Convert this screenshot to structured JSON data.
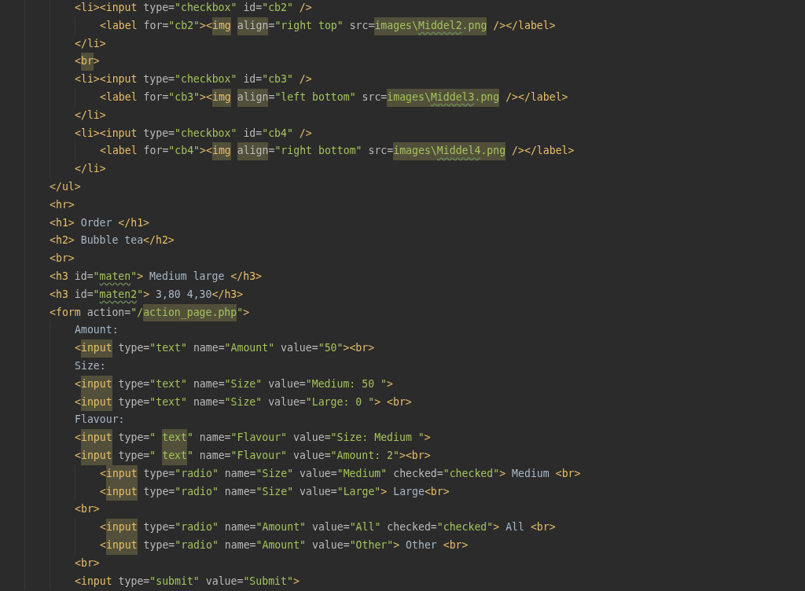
{
  "lines": [
    {
      "children": [
        {
          "tokens": [
            {
              "kind": "tag",
              "text": "<li><input"
            },
            {
              "kind": "attr",
              "text": " type="
            },
            {
              "kind": "string",
              "text": "\"checkbox\""
            },
            {
              "kind": "attr",
              "text": " id="
            },
            {
              "kind": "string",
              "text": "\"cb2\""
            },
            {
              "kind": "tag",
              "text": " />"
            }
          ],
          "children": [
            {
              "tokens": [
                {
                  "kind": "tag",
                  "text": "<label"
                },
                {
                  "kind": "attr",
                  "text": " for="
                },
                {
                  "kind": "string",
                  "text": "\"cb2\""
                },
                {
                  "kind": "tag",
                  "text": "><"
                },
                {
                  "kind": "tagmark",
                  "text": "img"
                },
                {
                  "kind": "attrmark",
                  "text": " align"
                },
                {
                  "kind": "attr",
                  "text": "="
                },
                {
                  "kind": "string",
                  "text": "\"right top\""
                },
                {
                  "kind": "attr",
                  "text": " src="
                },
                {
                  "kind": "stringmark",
                  "text": "images\\"
                },
                {
                  "kind": "stringmarktypo",
                  "text": "Middel2"
                },
                {
                  "kind": "stringmark",
                  "text": ".png"
                },
                {
                  "kind": "tag",
                  "text": " /></label>"
                }
              ]
            }
          ]
        },
        {
          "tokens": [
            {
              "kind": "tag",
              "text": "</li>"
            }
          ]
        },
        {
          "tokens": [
            {
              "kind": "tag",
              "text": "<"
            },
            {
              "kind": "tagmark",
              "text": "br"
            },
            {
              "kind": "tag",
              "text": ">"
            }
          ]
        },
        {
          "tokens": [
            {
              "kind": "tag",
              "text": "<li><input"
            },
            {
              "kind": "attr",
              "text": " type="
            },
            {
              "kind": "string",
              "text": "\"checkbox\""
            },
            {
              "kind": "attr",
              "text": " id="
            },
            {
              "kind": "string",
              "text": "\"cb3\""
            },
            {
              "kind": "tag",
              "text": " />"
            }
          ],
          "children": [
            {
              "tokens": [
                {
                  "kind": "tag",
                  "text": "<label"
                },
                {
                  "kind": "attr",
                  "text": " for="
                },
                {
                  "kind": "string",
                  "text": "\"cb3\""
                },
                {
                  "kind": "tag",
                  "text": "><"
                },
                {
                  "kind": "tagmark",
                  "text": "img"
                },
                {
                  "kind": "attrmark",
                  "text": " align"
                },
                {
                  "kind": "attr",
                  "text": "="
                },
                {
                  "kind": "string",
                  "text": "\"left bottom\""
                },
                {
                  "kind": "attr",
                  "text": " src="
                },
                {
                  "kind": "stringmark",
                  "text": "images\\"
                },
                {
                  "kind": "stringmarktypo",
                  "text": "Middel3"
                },
                {
                  "kind": "stringmark",
                  "text": ".png"
                },
                {
                  "kind": "tag",
                  "text": " /></label>"
                }
              ]
            }
          ]
        },
        {
          "tokens": [
            {
              "kind": "tag",
              "text": "</li>"
            }
          ]
        },
        {
          "tokens": [
            {
              "kind": "tag",
              "text": "<li><input"
            },
            {
              "kind": "attr",
              "text": " type="
            },
            {
              "kind": "string",
              "text": "\"checkbox\""
            },
            {
              "kind": "attr",
              "text": " id="
            },
            {
              "kind": "string",
              "text": "\"cb4\""
            },
            {
              "kind": "tag",
              "text": " />"
            }
          ],
          "children": [
            {
              "tokens": [
                {
                  "kind": "tag",
                  "text": "<label"
                },
                {
                  "kind": "attr",
                  "text": " for="
                },
                {
                  "kind": "string",
                  "text": "\"cb4\""
                },
                {
                  "kind": "tag",
                  "text": "><"
                },
                {
                  "kind": "tagmark",
                  "text": "img"
                },
                {
                  "kind": "attrmark",
                  "text": " align"
                },
                {
                  "kind": "attr",
                  "text": "="
                },
                {
                  "kind": "string",
                  "text": "\"right bottom\""
                },
                {
                  "kind": "attr",
                  "text": " src="
                },
                {
                  "kind": "stringmark",
                  "text": "images\\"
                },
                {
                  "kind": "stringmarktypo",
                  "text": "Middel4"
                },
                {
                  "kind": "stringmark",
                  "text": ".png"
                },
                {
                  "kind": "tag",
                  "text": " /></label>"
                }
              ]
            }
          ]
        },
        {
          "tokens": [
            {
              "kind": "tag",
              "text": "</li>"
            }
          ]
        }
      ]
    },
    {
      "tokens": [
        {
          "kind": "tag",
          "text": "</ul>"
        }
      ]
    },
    {
      "tokens": [
        {
          "kind": "tag",
          "text": "<hr>"
        }
      ]
    },
    {
      "tokens": [
        {
          "kind": "tag",
          "text": "<h1>"
        },
        {
          "kind": "plain",
          "text": " Order "
        },
        {
          "kind": "tag",
          "text": "</h1>"
        }
      ]
    },
    {
      "tokens": [
        {
          "kind": "tag",
          "text": "<h2>"
        },
        {
          "kind": "plain",
          "text": " Bubble tea"
        },
        {
          "kind": "tag",
          "text": "</h2>"
        }
      ]
    },
    {
      "tokens": [
        {
          "kind": "tag",
          "text": "<br>"
        }
      ]
    },
    {
      "tokens": [
        {
          "kind": "tag",
          "text": "<h3"
        },
        {
          "kind": "attr",
          "text": " id="
        },
        {
          "kind": "string",
          "text": "\""
        },
        {
          "kind": "stringtypo",
          "text": "maten"
        },
        {
          "kind": "string",
          "text": "\""
        },
        {
          "kind": "tag",
          "text": ">"
        },
        {
          "kind": "plain",
          "text": " Medium large "
        },
        {
          "kind": "tag",
          "text": "</h3>"
        }
      ]
    },
    {
      "tokens": [
        {
          "kind": "tag",
          "text": "<h3"
        },
        {
          "kind": "attr",
          "text": " id="
        },
        {
          "kind": "string",
          "text": "\""
        },
        {
          "kind": "stringtypo",
          "text": "maten2"
        },
        {
          "kind": "string",
          "text": "\""
        },
        {
          "kind": "tag",
          "text": ">"
        },
        {
          "kind": "plain",
          "text": " 3,80 4,30"
        },
        {
          "kind": "tag",
          "text": "</h3>"
        }
      ]
    },
    {
      "tokens": [
        {
          "kind": "tag",
          "text": "<form"
        },
        {
          "kind": "attr",
          "text": " action="
        },
        {
          "kind": "string",
          "text": "\"/"
        },
        {
          "kind": "stringmark",
          "text": "action_page.php"
        },
        {
          "kind": "string",
          "text": "\""
        },
        {
          "kind": "tag",
          "text": ">"
        }
      ],
      "children": [
        {
          "tokens": [
            {
              "kind": "plain",
              "text": "Amount:"
            }
          ]
        },
        {
          "tokens": [
            {
              "kind": "tag",
              "text": "<"
            },
            {
              "kind": "tagmark",
              "text": "input"
            },
            {
              "kind": "attr",
              "text": " type="
            },
            {
              "kind": "string",
              "text": "\"text\""
            },
            {
              "kind": "attr",
              "text": " name="
            },
            {
              "kind": "string",
              "text": "\"Amount\""
            },
            {
              "kind": "attr",
              "text": " value="
            },
            {
              "kind": "string",
              "text": "\"50\""
            },
            {
              "kind": "tag",
              "text": "><br>"
            }
          ]
        },
        {
          "tokens": [
            {
              "kind": "plain",
              "text": "Size:"
            }
          ]
        },
        {
          "tokens": [
            {
              "kind": "tag",
              "text": "<"
            },
            {
              "kind": "tagmark",
              "text": "input"
            },
            {
              "kind": "attr",
              "text": " type="
            },
            {
              "kind": "string",
              "text": "\"text\""
            },
            {
              "kind": "attr",
              "text": " name="
            },
            {
              "kind": "string",
              "text": "\"Size\""
            },
            {
              "kind": "attr",
              "text": " value="
            },
            {
              "kind": "string",
              "text": "\"Medium: 50 \""
            },
            {
              "kind": "tag",
              "text": ">"
            }
          ]
        },
        {
          "tokens": [
            {
              "kind": "tag",
              "text": "<"
            },
            {
              "kind": "tagmark",
              "text": "input"
            },
            {
              "kind": "attr",
              "text": " type="
            },
            {
              "kind": "string",
              "text": "\"text\""
            },
            {
              "kind": "attr",
              "text": " name="
            },
            {
              "kind": "string",
              "text": "\"Size\""
            },
            {
              "kind": "attr",
              "text": " value="
            },
            {
              "kind": "string",
              "text": "\"Large: 0 \""
            },
            {
              "kind": "tag",
              "text": "> <br>"
            }
          ]
        },
        {
          "tokens": [
            {
              "kind": "plain",
              "text": "Flavour:"
            }
          ]
        },
        {
          "tokens": [
            {
              "kind": "tag",
              "text": "<"
            },
            {
              "kind": "tagmark",
              "text": "input"
            },
            {
              "kind": "attr",
              "text": " type="
            },
            {
              "kind": "string",
              "text": "\""
            },
            {
              "kind": "stringmark",
              "text": " text"
            },
            {
              "kind": "string",
              "text": "\""
            },
            {
              "kind": "attr",
              "text": " name="
            },
            {
              "kind": "string",
              "text": "\"Flavour\""
            },
            {
              "kind": "attr",
              "text": " value="
            },
            {
              "kind": "string",
              "text": "\"Size: Medium \""
            },
            {
              "kind": "tag",
              "text": ">"
            }
          ]
        },
        {
          "tokens": [
            {
              "kind": "tag",
              "text": "<"
            },
            {
              "kind": "tagmark",
              "text": "input"
            },
            {
              "kind": "attr",
              "text": " type="
            },
            {
              "kind": "string",
              "text": "\""
            },
            {
              "kind": "stringmark",
              "text": " text"
            },
            {
              "kind": "string",
              "text": "\""
            },
            {
              "kind": "attr",
              "text": " name="
            },
            {
              "kind": "string",
              "text": "\"Flavour\""
            },
            {
              "kind": "attr",
              "text": " value="
            },
            {
              "kind": "string",
              "text": "\"Amount: 2\""
            },
            {
              "kind": "tag",
              "text": "><br>"
            }
          ],
          "children": [
            {
              "tokens": [
                {
                  "kind": "tag",
                  "text": "<"
                },
                {
                  "kind": "tagmark",
                  "text": "input"
                },
                {
                  "kind": "attr",
                  "text": " type="
                },
                {
                  "kind": "string",
                  "text": "\"radio\""
                },
                {
                  "kind": "attr",
                  "text": " name="
                },
                {
                  "kind": "string",
                  "text": "\"Size\""
                },
                {
                  "kind": "attr",
                  "text": " value="
                },
                {
                  "kind": "string",
                  "text": "\"Medium\""
                },
                {
                  "kind": "attr",
                  "text": " checked="
                },
                {
                  "kind": "string",
                  "text": "\"checked\""
                },
                {
                  "kind": "tag",
                  "text": ">"
                },
                {
                  "kind": "plain",
                  "text": " Medium "
                },
                {
                  "kind": "tag",
                  "text": "<br>"
                }
              ]
            },
            {
              "tokens": [
                {
                  "kind": "tag",
                  "text": "<"
                },
                {
                  "kind": "tagmark",
                  "text": "input"
                },
                {
                  "kind": "attr",
                  "text": " type="
                },
                {
                  "kind": "string",
                  "text": "\"radio\""
                },
                {
                  "kind": "attr",
                  "text": " name="
                },
                {
                  "kind": "string",
                  "text": "\"Size\""
                },
                {
                  "kind": "attr",
                  "text": " value="
                },
                {
                  "kind": "string",
                  "text": "\"Large\""
                },
                {
                  "kind": "tag",
                  "text": ">"
                },
                {
                  "kind": "plain",
                  "text": " Large"
                },
                {
                  "kind": "tag",
                  "text": "<br>"
                }
              ]
            }
          ]
        },
        {
          "tokens": [
            {
              "kind": "tag",
              "text": "<br>"
            }
          ],
          "children": [
            {
              "tokens": [
                {
                  "kind": "tag",
                  "text": "<"
                },
                {
                  "kind": "tagmark",
                  "text": "input"
                },
                {
                  "kind": "attr",
                  "text": " type="
                },
                {
                  "kind": "string",
                  "text": "\"radio\""
                },
                {
                  "kind": "attr",
                  "text": " name="
                },
                {
                  "kind": "string",
                  "text": "\"Amount\""
                },
                {
                  "kind": "attr",
                  "text": " value="
                },
                {
                  "kind": "string",
                  "text": "\"All\""
                },
                {
                  "kind": "attr",
                  "text": " checked="
                },
                {
                  "kind": "string",
                  "text": "\"checked\""
                },
                {
                  "kind": "tag",
                  "text": ">"
                },
                {
                  "kind": "plain",
                  "text": " All "
                },
                {
                  "kind": "tag",
                  "text": "<br>"
                }
              ]
            },
            {
              "tokens": [
                {
                  "kind": "tag",
                  "text": "<"
                },
                {
                  "kind": "tagmark",
                  "text": "input"
                },
                {
                  "kind": "attr",
                  "text": " type="
                },
                {
                  "kind": "string",
                  "text": "\"radio\""
                },
                {
                  "kind": "attr",
                  "text": " name="
                },
                {
                  "kind": "string",
                  "text": "\"Amount\""
                },
                {
                  "kind": "attr",
                  "text": " value="
                },
                {
                  "kind": "string",
                  "text": "\"Other\""
                },
                {
                  "kind": "tag",
                  "text": ">"
                },
                {
                  "kind": "plain",
                  "text": " Other "
                },
                {
                  "kind": "tag",
                  "text": "<br>"
                }
              ]
            }
          ]
        },
        {
          "tokens": [
            {
              "kind": "tag",
              "text": "<br>"
            }
          ]
        },
        {
          "tokens": [
            {
              "kind": "tag",
              "text": "<input"
            },
            {
              "kind": "attr",
              "text": " type="
            },
            {
              "kind": "string",
              "text": "\"submit\""
            },
            {
              "kind": "attr",
              "text": " value="
            },
            {
              "kind": "string",
              "text": "\"Submit\""
            },
            {
              "kind": "tag",
              "text": ">"
            }
          ]
        }
      ]
    }
  ]
}
